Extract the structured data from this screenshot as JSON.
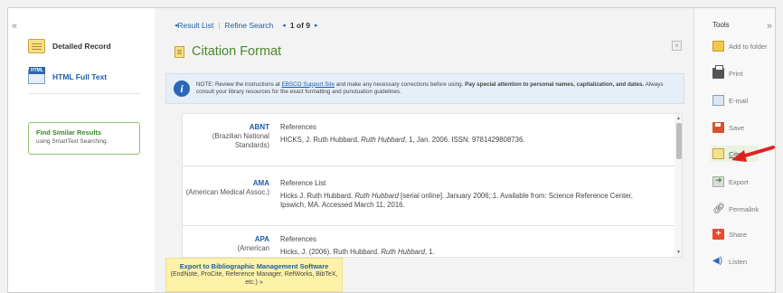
{
  "left_panel": {
    "collapse_glyph": "«",
    "detailed_record": "Detailed Record",
    "html_full_text": "HTML Full Text",
    "html_icon_text": "HTML",
    "find_similar_title": "Find Similar Results",
    "find_similar_sub": "using SmartText Searching."
  },
  "nav": {
    "result_list": "Result List",
    "refine_search": "Refine Search",
    "page_text": "1 of 9"
  },
  "page_title": "Citation Format",
  "close_glyph": "×",
  "note": {
    "prefix": "NOTE: Review the instructions at ",
    "link": "EBSCO Support Site",
    "middle": " and make any necessary corrections before using. ",
    "bold": "Pay special attention to personal names, capitalization, and dates.",
    "suffix": " Always consult your library resources for the exact formatting and punctuation guidelines."
  },
  "citations": [
    {
      "style": "ABNT",
      "desc": "(Brazilian National Standards)",
      "heading": "References",
      "pre": "HICKS, J. Ruth Hubbard. ",
      "italic": "Ruth Hubbard",
      "post": ", 1, Jan. 2006. ISSN: 9781429808736."
    },
    {
      "style": "AMA",
      "desc": "(American Medical Assoc.)",
      "heading": "Reference List",
      "pre": "Hicks J. Ruth Hubbard. ",
      "italic": "Ruth Hubbard",
      "post": " [serial online]. January 2006;:1. Available from: Science Reference Center, Ipswich, MA. Accessed March 11, 2016."
    },
    {
      "style": "APA",
      "desc": "(American",
      "heading": "References",
      "pre": "Hicks, J. (2006). Ruth Hubbard. ",
      "italic": "Ruth Hubbard",
      "post": ", 1."
    }
  ],
  "export": {
    "title": "Export to Bibliographic Management Software",
    "sub": "(EndNote, ProCite, Reference Manager, RefWorks, BibTeX, etc.) »"
  },
  "tools": {
    "title": "Tools",
    "collapse_glyph": "»",
    "items": [
      {
        "label": "Add to folder",
        "icon": "folder-icon"
      },
      {
        "label": "Print",
        "icon": "printer-icon"
      },
      {
        "label": "E-mail",
        "icon": "email-icon"
      },
      {
        "label": "Save",
        "icon": "save-icon"
      },
      {
        "label": "Cite",
        "icon": "cite-icon"
      },
      {
        "label": "Export",
        "icon": "export-icon"
      },
      {
        "label": "Permalink",
        "icon": "link-icon"
      },
      {
        "label": "Share",
        "icon": "share-icon"
      },
      {
        "label": "Listen",
        "icon": "speaker-icon"
      }
    ]
  },
  "colors": {
    "accent_green": "#4a8a2a",
    "link_blue": "#1a5fa8",
    "arrow_red": "#e02020",
    "export_yellow": "#fdf2a8"
  }
}
